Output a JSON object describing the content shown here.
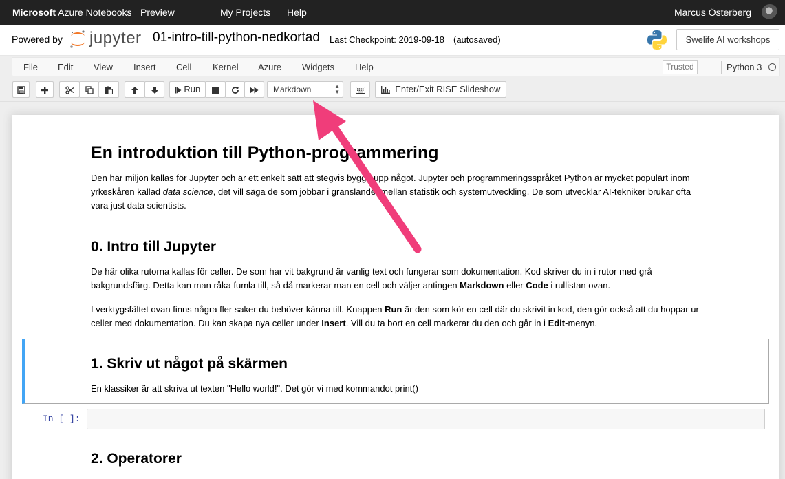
{
  "azure_bar": {
    "brand_bold": "Microsoft",
    "brand_rest": " Azure Notebooks",
    "preview": "Preview",
    "my_projects": "My Projects",
    "help": "Help",
    "user_name": "Marcus Österberg"
  },
  "header": {
    "powered_by": "Powered by",
    "jupyter_word": "jupyter",
    "notebook_name": "01-intro-till-python-nedkortad",
    "checkpoint": "Last Checkpoint: 2019-09-18",
    "autosaved": "(autosaved)",
    "project_button": "Swelife AI workshops"
  },
  "menu": {
    "items": [
      "File",
      "Edit",
      "View",
      "Insert",
      "Cell",
      "Kernel",
      "Azure",
      "Widgets",
      "Help"
    ],
    "trusted": "Trusted",
    "kernel": "Python 3"
  },
  "toolbar": {
    "run_label": "Run",
    "cell_type": "Markdown",
    "rise_label": "Enter/Exit RISE Slideshow",
    "icons": [
      "save-icon",
      "plus-icon",
      "cut-icon",
      "copy-icon",
      "paste-icon",
      "arrow-up-icon",
      "arrow-down-icon",
      "step-forward-icon",
      "stop-icon",
      "restart-icon",
      "fast-forward-icon",
      "keyboard-icon",
      "bar-chart-icon"
    ]
  },
  "notebook": {
    "title": "En introduktion till Python-programmering",
    "intro_p1": "Den här miljön kallas för Jupyter och är ett enkelt sätt att stegvis bygga upp något. Jupyter och programmeringsspråket Python är mycket populärt inom",
    "intro_p2a": "yrkeskåren kallad ",
    "intro_p2_em": "data science",
    "intro_p2b": ", det vill säga de som jobbar i gränslandet mellan statistik och systemutveckling. De som utvecklar AI-tekniker brukar ofta",
    "intro_p3": "vara just data scientists.",
    "section0_title": "0. Intro till Jupyter",
    "s0_p1_l1": "De här olika rutorna kallas för celler. De som har vit bakgrund är vanlig text och fungerar som dokumentation. Kod skriver du in i rutor med grå",
    "s0_p1_l2a": "bakgrundsfärg. Detta kan man råka fumla till, så då markerar man en cell och väljer antingen ",
    "s0_p1_markdown": "Markdown",
    "s0_p1_or": " eller ",
    "s0_p1_code": "Code",
    "s0_p1_l2b": " i rullistan ovan.",
    "s0_p2_l1a": "I verktygsfältet ovan finns några fler saker du behöver känna till. Knappen ",
    "s0_p2_run": "Run",
    "s0_p2_l1b": " är den som kör en cell där du skrivit in kod, den gör också att du hoppar ur",
    "s0_p2_l2a": "celler med dokumentation. Du kan skapa nya celler under ",
    "s0_p2_insert": "Insert",
    "s0_p2_l2b": ". Vill du ta bort en cell markerar du den och går in i ",
    "s0_p2_edit": "Edit",
    "s0_p2_l2c": "-menyn.",
    "section1_title": "1. Skriv ut något på skärmen",
    "s1_p1": "En klassiker är att skriva ut texten \"Hello world!\". Det gör vi med kommandot print()",
    "prompt": "In [ ]:",
    "section2_title": "2. Operatorer"
  },
  "colors": {
    "top_bar": "#222222",
    "selected_cell_border": "#42a5f5",
    "prompt_blue": "#303f9f",
    "annotation_arrow": "#f03d7a"
  }
}
